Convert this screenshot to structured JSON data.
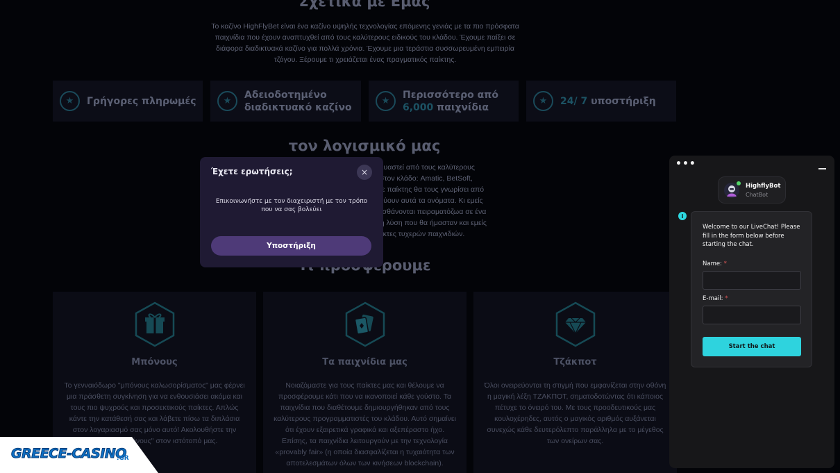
{
  "about": {
    "title": "Σχετικά με Εμάς",
    "text": "Το καζίνο HighFlyBet είναι ένα καζίνο υψηλής τεχνολογίας επόμενης γενιάς με τα πιο πρόσφατα παιχνίδια που έχουν αναπτυχθεί από τους καλύτερους ειδικούς του κλάδου. Έχουμε παίξει σε διάφορα διαδικτυακά καζίνο για πολλά χρόνια. Έχουμε μια τεράστια συσσωρευμένη εμπειρία τζόγου. Ξέρουμε τι χρειάζεται ένας πραγματικός παίκτης."
  },
  "features": [
    {
      "icon": "star-icon",
      "text": "Γρήγορες πληρωμές"
    },
    {
      "icon": "star-icon",
      "line1": "Αδειοδοτημένο",
      "line2": "διαδικτυακό καζίνο"
    },
    {
      "icon": "star-icon",
      "line1": "Περισσότερο από",
      "accent": "6,000",
      "line2rest": " παιχνίδια"
    },
    {
      "icon": "star-icon",
      "accent": "24/ 7",
      "rest": " υποστήριξη"
    }
  ],
  "software": {
    "title": "τον λογισμικό μας",
    "lines": [
      "ατασκευαστεί από τους καλύτερους",
      "αζίνο στον κλάδο: Amatic, BetSoft,",
      "s. Κάθε παίκτης θα τους γνωρίσει από",
      "οσωπεύουν αυτά τα ονόματα. Κι εμείς",
      "ς να αισθάνονται πειραματόζωα σε ένα",
      "λύτιστη λύση που θα ήμασταν και εμείς",
      "ως παίκτες τυχερών παιχνιδιών."
    ]
  },
  "offer": {
    "title": "Τι προσφέρουμε"
  },
  "cards": [
    {
      "icon": "gift-icon",
      "title": "Μπόνους",
      "text": "Το γενναιόδωρο \"μπόνους καλωσορίσματος\" μας φέρνει μια πράσθετη συγκίνηση για να ενθουσιάσει ακόμα και τους πιο ψυχρούς και προσεκτικούς παίκτες. Απλώς κάντε την κατάθεσή σας και λάβετε πίσω τα διπλάσια στον λογαριασμό σας μόνο αυτό! Ακολουθήστε την ενότητα \"Μπόνους\" στον ιστότοπό μας."
    },
    {
      "icon": "cards-icon",
      "title": "Τα παιχνίδια μας",
      "text": "Νοιαζόμαστε για τους παίκτες μας και θέλουμε να προσφέρουμε κάτι που να ικανοποιεί κάθε γούστο. Τα παιχνίδια που διαθέτουμε δημιουργήθηκαν από τους καλύτερους προγραμματιστές του κλάδου. Αυτό σημαίνει ότι έχουν εξαιρετικά γραφικά και αξεπέραστο ήχο. Επίσης, τα παιχνίδια λειτουργούν με την τεχνολογία «provably fair» (η οποία διασφαλίζεται η τυχαιότητα των αποτελεσμάτων όλων των κινήσεων blockchain)."
    },
    {
      "icon": "diamond-icon",
      "title": "Τζάκποτ",
      "text": "Όλοι ονειρεύονται τη στιγμή που εμφανίζεται στην οθόνη η μαγική λέξη ΤΖΑΚΠΟΤ, σηματοδοτώντας ότι κάποιος πέτυχε το όνειρό του. Με τους προοδευτικούς μας κουλοχέρηδες, αυτός ο μαγικός αριθμός αυξάνεται συνεχώς κάθε δευτερόλεπτο παράλληλα με το μέγεθος των ονείρων σας."
    }
  ],
  "modal": {
    "title": "Έχετε ερωτήσεις;",
    "close": "×",
    "text": "Επικοινωνήστε με τον διαχειριστή με τον τρόπο που να σας βολεύει",
    "button": "Υποστήριξη"
  },
  "chat": {
    "menu": "•••",
    "bot_name": "HighflyBot",
    "bot_role": "ChatBot",
    "welcome": "Welcome to our LiveChat! Please fill in the form below before starting the chat.",
    "name_label": "Name:",
    "email_label": "E-mail:",
    "required": "*",
    "name_value": "",
    "email_value": "",
    "start_button": "Start the chat"
  },
  "logo": {
    "text": "GREECE-CASINO",
    "suffix": ".GR"
  },
  "colors": {
    "accent_teal": "#2ed3de",
    "modal_button": "#4e3a78",
    "online": "#53d46b"
  }
}
